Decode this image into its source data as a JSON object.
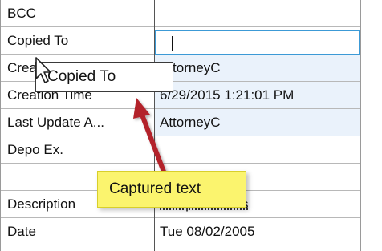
{
  "grid": {
    "rows": [
      {
        "name": "BCC",
        "value": ""
      },
      {
        "name": "Copied To",
        "value": ""
      },
      {
        "name": "Created By",
        "value": "AttorneyC"
      },
      {
        "name": "Creation Time",
        "value": "6/29/2015 1:21:01 PM"
      },
      {
        "name": "Last Update A...",
        "value": "AttorneyC"
      },
      {
        "name": "Depo Ex.",
        "value": ""
      },
      {
        "name": "Description",
        "value": "Philip Hawkins"
      },
      {
        "name": "Date",
        "value": "Tue 08/02/2005"
      }
    ]
  },
  "drag_label": {
    "text": "Copied To"
  },
  "callout": {
    "text": "Captured text"
  },
  "colors": {
    "edit_focus_border": "#3c9ad6",
    "callout_bg": "#fbf46e",
    "arrow": "#b3202a",
    "row_highlight": "#eaf2fb"
  },
  "icons": {
    "cursor": "arrow-cursor-icon",
    "annotation_arrow": "red-arrow-icon"
  }
}
